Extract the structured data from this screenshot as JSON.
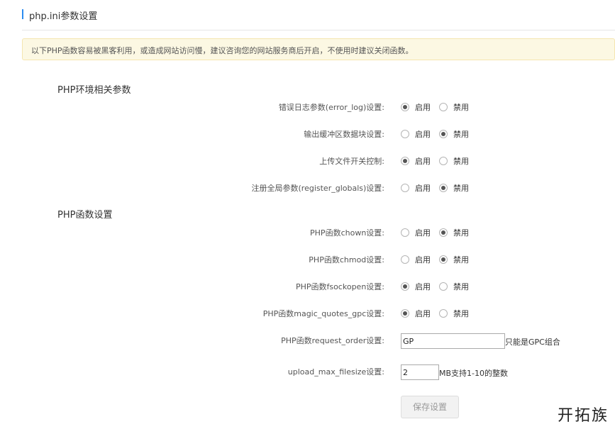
{
  "header": {
    "title": "php.ini参数设置"
  },
  "notice": {
    "text": "以下PHP函数容易被黑客利用，或造成网站访问慢，建议咨询您的网站服务商后开启，不使用时建议关闭函数。"
  },
  "sections": {
    "env": {
      "title": "PHP环境相关参数"
    },
    "functions": {
      "title": "PHP函数设置"
    }
  },
  "radio_labels": {
    "enable": "启用",
    "disable": "禁用"
  },
  "settings": [
    {
      "label": "错误日志参数(error_log)设置:",
      "selected": "enable"
    },
    {
      "label": "输出缓冲区数据块设置:",
      "selected": "disable"
    },
    {
      "label": "上传文件开关控制:",
      "selected": "enable"
    },
    {
      "label": "注册全局参数(register_globals)设置:",
      "selected": "disable"
    },
    {
      "label": "PHP函数chown设置:",
      "selected": "disable"
    },
    {
      "label": "PHP函数chmod设置:",
      "selected": "disable"
    },
    {
      "label": "PHP函数fsockopen设置:",
      "selected": "enable"
    },
    {
      "label": "PHP函数magic_quotes_gpc设置:",
      "selected": "enable"
    }
  ],
  "request_order": {
    "label": "PHP函数request_order设置:",
    "value": "GP",
    "hint": "只能是GPC组合"
  },
  "upload_max": {
    "label": "upload_max_filesize设置:",
    "value": "2",
    "hint": "MB支持1-10的整数"
  },
  "save_button": {
    "label": "保存设置"
  },
  "watermark": {
    "text": "开拓族"
  },
  "colors": {
    "accent": "#2d8cf0",
    "notice_bg": "#fcf8e3",
    "notice_border": "#f5e6b0"
  }
}
